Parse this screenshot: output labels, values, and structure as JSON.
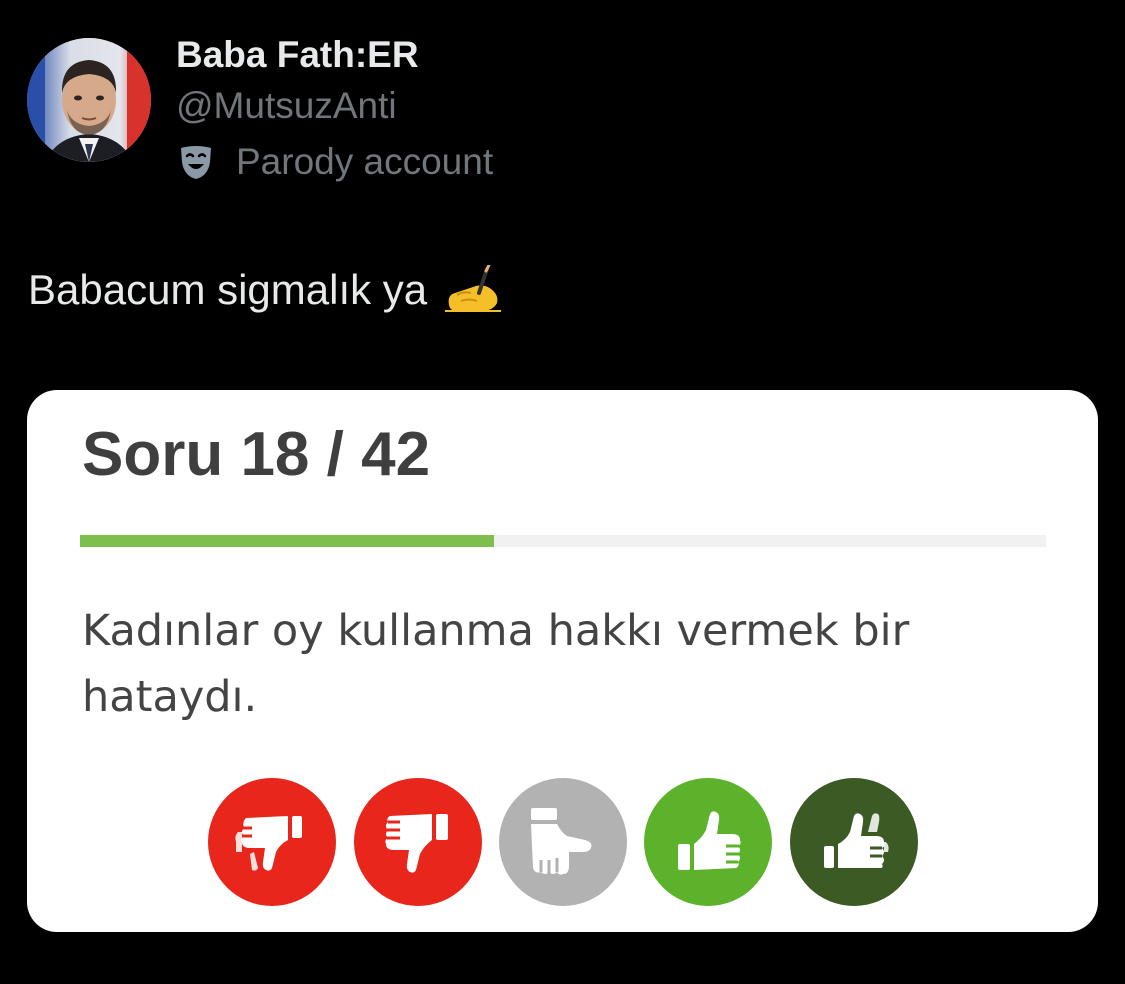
{
  "tweet": {
    "author": {
      "display_name": "Baba Fath:ER",
      "handle": "@MutsuzAnti",
      "label": "Parody account",
      "label_icon": "theater-mask-icon",
      "avatar_icon": "profile-photo"
    },
    "text": "Babacum sigmalık ya",
    "emoji": "writing-hand-icon"
  },
  "quiz_card": {
    "title": "Soru 18 / 42",
    "progress": {
      "current": 18,
      "total": 42,
      "fill_color": "#7cbf4d"
    },
    "question": "Kadınlar oy kullanma hakkı vermek bir hataydı.",
    "options": [
      {
        "icon": "double-thumbs-down-icon",
        "meaning": "strongly disagree",
        "color": "#e8261c"
      },
      {
        "icon": "thumbs-down-icon",
        "meaning": "disagree",
        "color": "#e8261c"
      },
      {
        "icon": "sideways-thumb-icon",
        "meaning": "neutral",
        "color": "#b2b2b2"
      },
      {
        "icon": "thumbs-up-icon",
        "meaning": "agree",
        "color": "#5db22b"
      },
      {
        "icon": "double-thumbs-up-icon",
        "meaning": "strongly agree",
        "color": "#3b5a24"
      }
    ]
  }
}
